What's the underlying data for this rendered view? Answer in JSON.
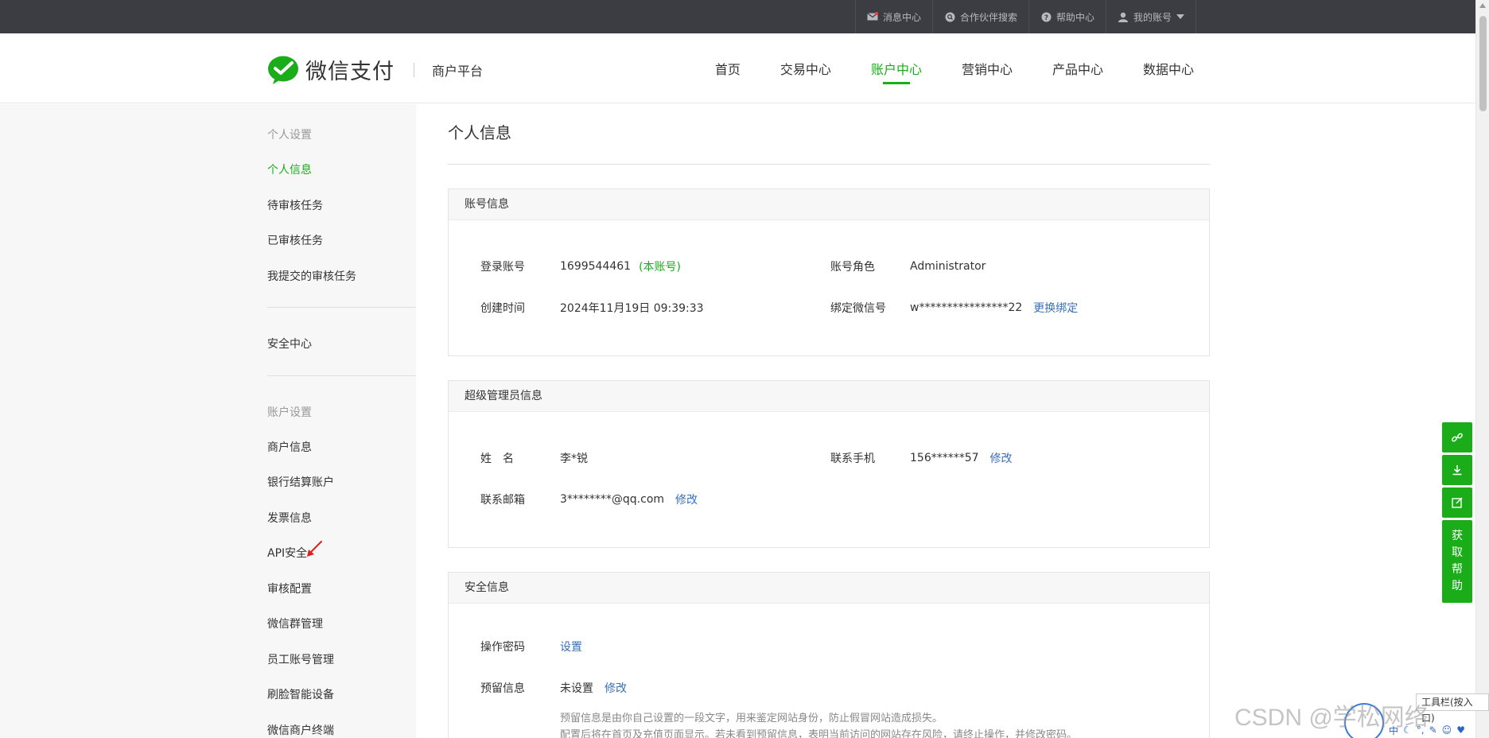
{
  "topbar": {
    "messages": "消息中心",
    "partner_search": "合作伙伴搜索",
    "help_center": "帮助中心",
    "my_account": "我的账号"
  },
  "header": {
    "logo_text": "微信支付",
    "platform": "商户平台",
    "nav": [
      "首页",
      "交易中心",
      "账户中心",
      "营销中心",
      "产品中心",
      "数据中心"
    ],
    "active_nav": "账户中心"
  },
  "sidebar": {
    "personal_settings_title": "个人设置",
    "personal_items": [
      "个人信息",
      "待审核任务",
      "已审核任务",
      "我提交的审核任务"
    ],
    "security_center": "安全中心",
    "account_settings_title": "账户设置",
    "account_items": [
      "商户信息",
      "银行结算账户",
      "发票信息",
      "API安全",
      "审核配置",
      "微信群管理",
      "员工账号管理",
      "刷脸智能设备",
      "微信商户终端"
    ]
  },
  "page": {
    "title": "个人信息",
    "account_info": {
      "title": "账号信息",
      "login_account_label": "登录账号",
      "login_account_value": "1699544461",
      "this_account_tag": "(本账号)",
      "role_label": "账号角色",
      "role_value": "Administrator",
      "created_label": "创建时间",
      "created_value": "2024年11月19日 09:39:33",
      "wechat_label": "绑定微信号",
      "wechat_value": "w****************22",
      "wechat_action": "更换绑定"
    },
    "admin_info": {
      "title": "超级管理员信息",
      "name_label": "姓　名",
      "name_value": "李*锐",
      "phone_label": "联系手机",
      "phone_value": "156******57",
      "phone_action": "修改",
      "email_label": "联系邮箱",
      "email_value": "3********@qq.com",
      "email_action": "修改"
    },
    "security_info": {
      "title": "安全信息",
      "op_password_label": "操作密码",
      "op_password_action": "设置",
      "reserved_label": "预留信息",
      "reserved_value": "未设置",
      "reserved_action": "修改",
      "note_1": "预留信息是由你自己设置的一段文字，用来鉴定网站身份，防止假冒网站造成损失。",
      "note_2": "配置后将在首页及充值页面显示。若未看到预留信息，表明当前访问的网站存在风险，请终止操作，并修改密码。"
    }
  },
  "float_bar": {
    "help_chars": [
      "获",
      "取",
      "帮",
      "助"
    ]
  },
  "overlay": {
    "watermark": "CSDN @学松网络",
    "ime_tip": "工具栏(按入口)",
    "ime_label": "中"
  },
  "colors": {
    "brand_green": "#1aad19",
    "topbar_bg": "#3b3d42",
    "link_blue": "#3a6fb7"
  }
}
